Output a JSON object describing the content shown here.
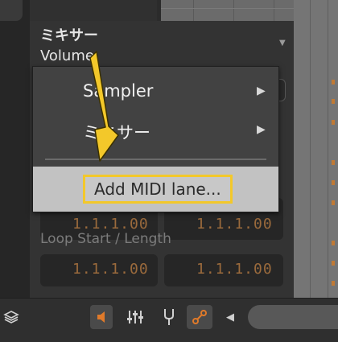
{
  "header": {
    "title": "ミキサー",
    "subtitle": "Volume"
  },
  "menu": {
    "items": [
      {
        "label": "Sampler",
        "has_submenu": true
      },
      {
        "label": "ミキサー",
        "has_submenu": true
      }
    ],
    "highlighted": {
      "label": "Add MIDI lane..."
    },
    "submenu_glyph": "▶"
  },
  "fields": {
    "row1": [
      "1.1.1.00",
      "1.1.1.00"
    ],
    "loop_label": "Loop Start / Length",
    "loop_values": [
      "1.1.1.00",
      "1.1.1.00"
    ]
  },
  "toolbar": {
    "icons": [
      "layers-icon",
      "speaker-icon",
      "mixer-faders-icon",
      "tuning-fork-icon",
      "modulation-icon",
      "scroll-left-arrow-icon"
    ],
    "scroll_left_glyph": "◀"
  },
  "colors": {
    "accent_orange": "#e07a2a",
    "highlight_border": "#f3c82a",
    "annotation_arrow": "#f3c82a",
    "value_text": "#9a6a3c"
  }
}
